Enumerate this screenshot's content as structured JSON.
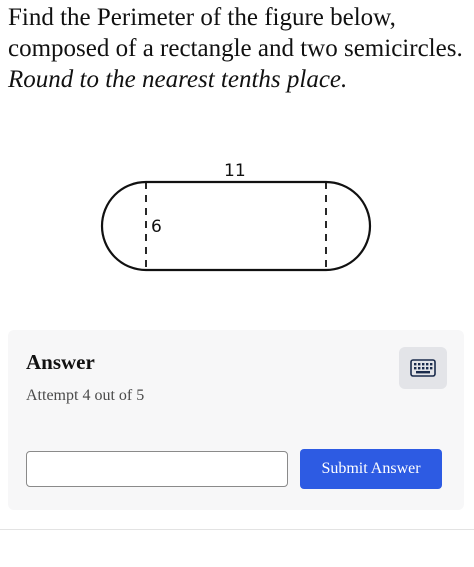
{
  "question": {
    "text": "Find the Perimeter of the figure below, composed of a rectangle and two semicircles.",
    "instruction": "Round to the nearest tenths place."
  },
  "figure": {
    "length_label": "11",
    "diameter_label": "6"
  },
  "answer": {
    "title": "Answer",
    "attempt": "Attempt 4 out of 5",
    "input_value": "",
    "submit_label": "Submit Answer",
    "keyboard_icon": "keyboard-icon"
  },
  "colors": {
    "submit_bg": "#2d5be3",
    "panel_bg": "#f7f7f8",
    "keyboard_btn_bg": "#e3e4e8"
  }
}
